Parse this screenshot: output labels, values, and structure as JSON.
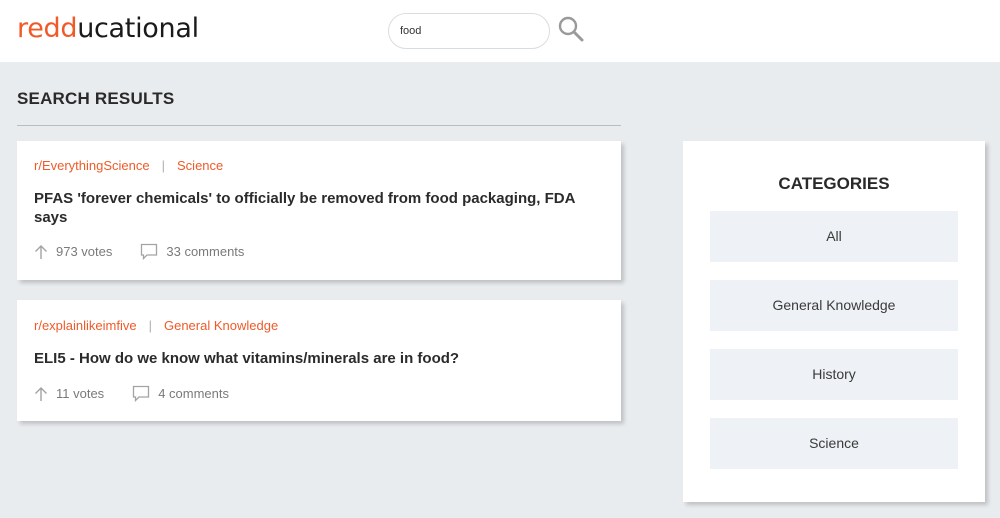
{
  "app": {
    "logo_accent": "redd",
    "logo_rest": "ucational",
    "accent_color": "#f05a28"
  },
  "search": {
    "value": "food",
    "icon": "search-icon"
  },
  "main": {
    "title": "SEARCH RESULTS",
    "results": [
      {
        "subreddit": "r/EverythingScience",
        "category": "Science",
        "title": "PFAS 'forever chemicals' to officially be removed from food packaging, FDA says",
        "votes": "973 votes",
        "comments": "33 comments"
      },
      {
        "subreddit": "r/explainlikeimfive",
        "category": "General Knowledge",
        "title": "ELI5 - How do we know what vitamins/minerals are in food?",
        "votes": "11 votes",
        "comments": "4 comments"
      }
    ]
  },
  "sidebar": {
    "title": "CATEGORIES",
    "items": [
      "All",
      "General Knowledge",
      "History",
      "Science"
    ]
  }
}
